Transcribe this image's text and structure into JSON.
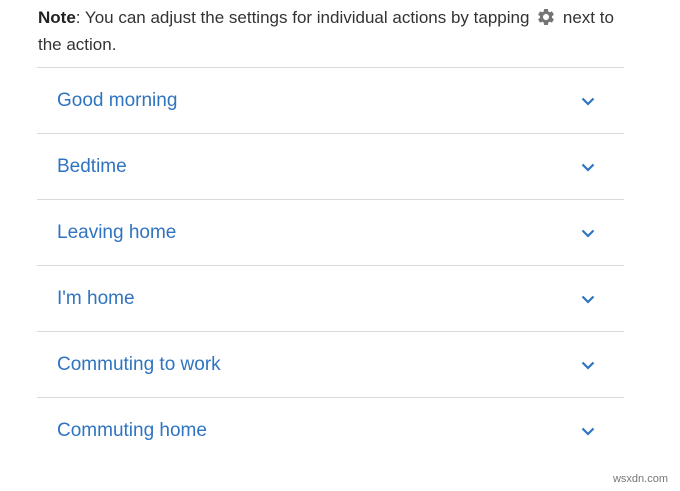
{
  "note": {
    "label": "Note",
    "text_before_icon": ": You can adjust the settings for individual actions by tapping ",
    "icon": "gear-icon",
    "text_after_icon": " next to the action."
  },
  "routines": [
    {
      "label": "Good morning",
      "icon": "chevron-down-icon"
    },
    {
      "label": "Bedtime",
      "icon": "chevron-down-icon"
    },
    {
      "label": "Leaving home",
      "icon": "chevron-down-icon"
    },
    {
      "label": "I'm home",
      "icon": "chevron-down-icon"
    },
    {
      "label": "Commuting to work",
      "icon": "chevron-down-icon"
    },
    {
      "label": "Commuting home",
      "icon": "chevron-down-icon"
    }
  ],
  "colors": {
    "link_blue": "#2f74c0",
    "divider": "#dadada",
    "text": "#333333"
  },
  "watermark": "wsxdn.com"
}
